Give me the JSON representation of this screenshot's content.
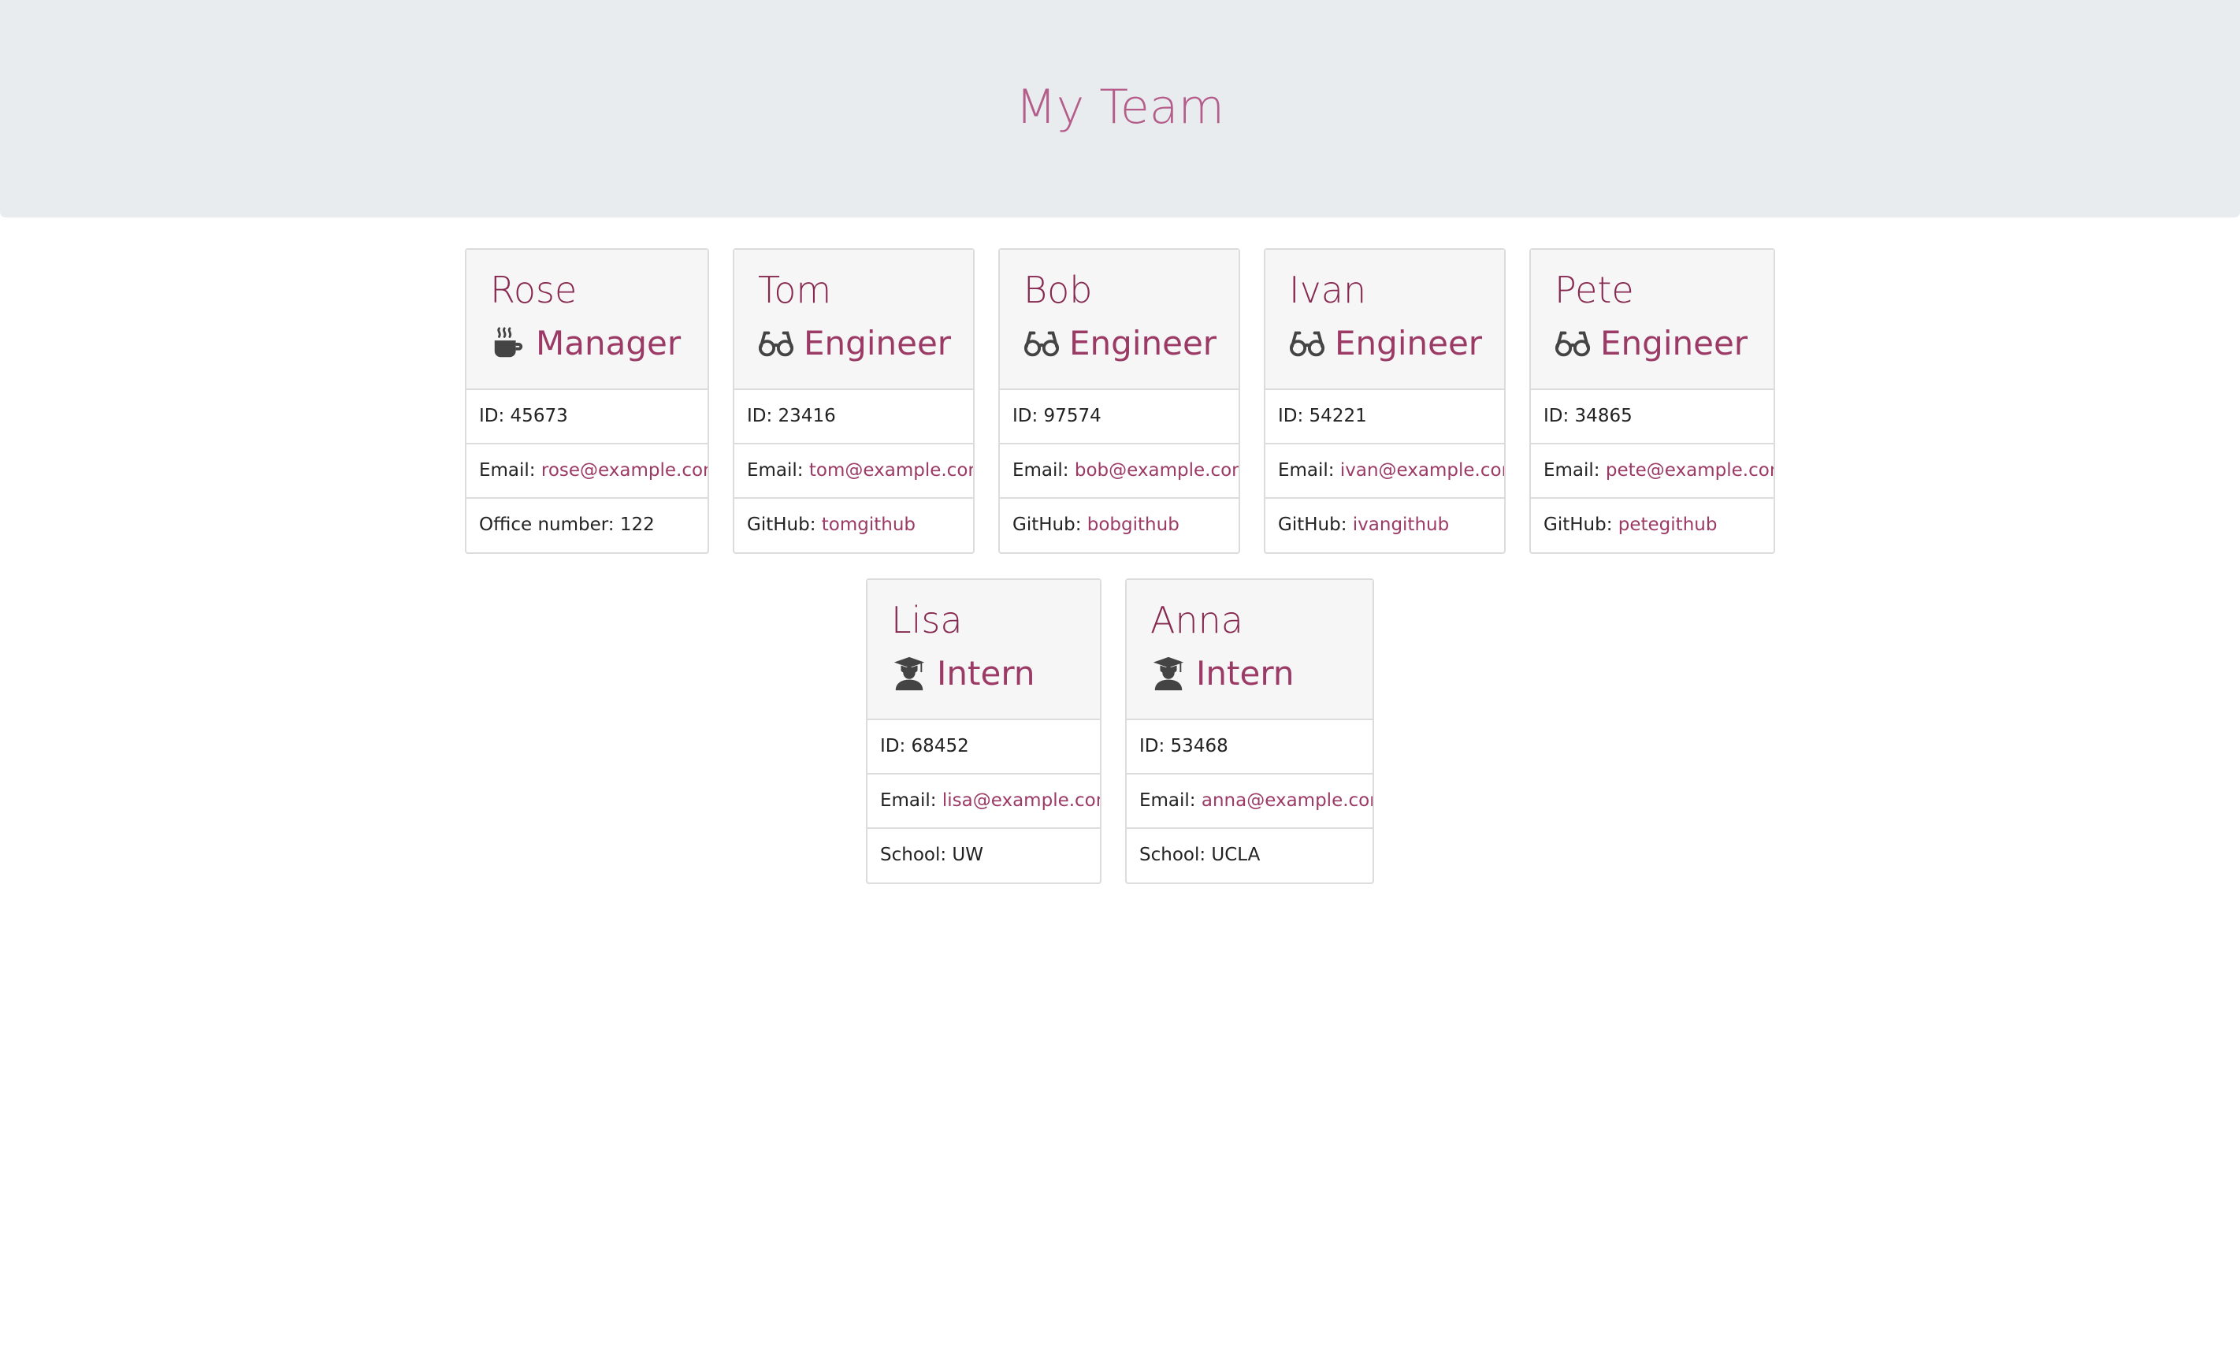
{
  "header": {
    "title": "My Team"
  },
  "colors": {
    "accent": "#b45c8a",
    "name": "#86284f",
    "link": "#9c3a66",
    "jumbotron": "#e9ecef"
  },
  "employees": [
    {
      "name": "Rose",
      "role": "Manager",
      "icon": "coffee-icon",
      "id_label": "ID: 45673",
      "email_label": "Email: ",
      "email": "rose@example.com",
      "extra_label": "Office number: 122",
      "extra_link": ""
    },
    {
      "name": "Tom",
      "role": "Engineer",
      "icon": "glasses-icon",
      "id_label": "ID: 23416",
      "email_label": "Email: ",
      "email": "tom@example.com",
      "extra_label": "GitHub: ",
      "extra_link": "tomgithub"
    },
    {
      "name": "Bob",
      "role": "Engineer",
      "icon": "glasses-icon",
      "id_label": "ID: 97574",
      "email_label": "Email: ",
      "email": "bob@example.com",
      "extra_label": "GitHub: ",
      "extra_link": "bobgithub"
    },
    {
      "name": "Ivan",
      "role": "Engineer",
      "icon": "glasses-icon",
      "id_label": "ID: 54221",
      "email_label": "Email: ",
      "email": "ivan@example.com",
      "extra_label": "GitHub: ",
      "extra_link": "ivangithub"
    },
    {
      "name": "Pete",
      "role": "Engineer",
      "icon": "glasses-icon",
      "id_label": "ID: 34865",
      "email_label": "Email: ",
      "email": "pete@example.com",
      "extra_label": "GitHub: ",
      "extra_link": "petegithub"
    },
    {
      "name": "Lisa",
      "role": "Intern",
      "icon": "graduate-icon",
      "id_label": "ID: 68452",
      "email_label": "Email: ",
      "email": "lisa@example.com",
      "extra_label": "School: UW",
      "extra_link": ""
    },
    {
      "name": "Anna",
      "role": "Intern",
      "icon": "graduate-icon",
      "id_label": "ID: 53468",
      "email_label": "Email: ",
      "email": "anna@example.com",
      "extra_label": "School: UCLA",
      "extra_link": ""
    }
  ]
}
